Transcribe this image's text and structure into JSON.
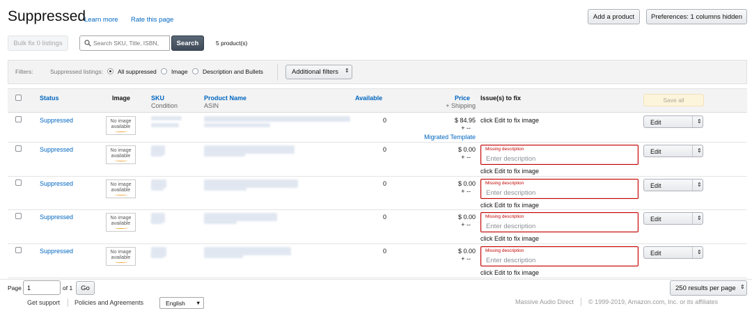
{
  "header": {
    "title": "Suppressed",
    "learn_more": "Learn more",
    "rate_page": "Rate this page",
    "add_product": "Add a product",
    "preferences": "Preferences: 1 columns hidden"
  },
  "toolbar": {
    "bulk_fix": "Bulk fix 0 listings",
    "search_placeholder": "Search SKU, Title, ISBN,",
    "search_button": "Search",
    "product_count": "5 product(s)"
  },
  "filters": {
    "label": "Filters:",
    "group_label": "Suppressed listings:",
    "options": [
      {
        "label": "All suppressed",
        "selected": true
      },
      {
        "label": "Image",
        "selected": false
      },
      {
        "label": "Description and Bullets",
        "selected": false
      }
    ],
    "additional": "Additional filters",
    "additional_arrow": "⇕"
  },
  "table": {
    "headers": {
      "status": "Status",
      "image": "Image",
      "sku": "SKU",
      "sku_sub": "Condition",
      "product_name": "Product Name",
      "product_sub": "ASIN",
      "available": "Available",
      "price": "Price",
      "price_sub": "+ Shipping",
      "issues": "Issue(s) to fix",
      "save_all": "Save all"
    },
    "no_image_line1": "No image",
    "no_image_line2": "available",
    "rows": [
      {
        "status": "Suppressed",
        "available": "0",
        "price": "$ 84.95",
        "shipping": "+ --",
        "extra": "Migrated Template",
        "issue_label": "",
        "issue_placeholder": "",
        "fix_text": "click Edit to fix image",
        "edit": "Edit",
        "edit_arrow": "⇕"
      },
      {
        "status": "Suppressed",
        "available": "0",
        "price": "$ 0.00",
        "shipping": "+ --",
        "extra": "",
        "issue_label": "Missing description",
        "issue_placeholder": "Enter description",
        "fix_text": "click Edit to fix image",
        "edit": "Edit",
        "edit_arrow": "⇕"
      },
      {
        "status": "Suppressed",
        "available": "0",
        "price": "$ 0.00",
        "shipping": "+ --",
        "extra": "",
        "issue_label": "Missing description",
        "issue_placeholder": "Enter description",
        "fix_text": "click Edit to fix image",
        "edit": "Edit",
        "edit_arrow": "⇕"
      },
      {
        "status": "Suppressed",
        "available": "0",
        "price": "$ 0.00",
        "shipping": "+ --",
        "extra": "",
        "issue_label": "Missing description",
        "issue_placeholder": "Enter description",
        "fix_text": "click Edit to fix image",
        "edit": "Edit",
        "edit_arrow": "⇕"
      },
      {
        "status": "Suppressed",
        "available": "0",
        "price": "$ 0.00",
        "shipping": "+ --",
        "extra": "",
        "issue_label": "Missing description",
        "issue_placeholder": "Enter description",
        "fix_text": "click Edit to fix image",
        "edit": "Edit",
        "edit_arrow": "⇕"
      }
    ]
  },
  "pagination": {
    "page_label": "Page",
    "page_value": "1",
    "of_label": "of 1",
    "go": "Go",
    "per_page": "250 results per page",
    "per_page_arrow": "⇕"
  },
  "footer": {
    "support": "Get support",
    "policies": "Policies and Agreements",
    "language": "English",
    "language_arrow": "▼",
    "store": "Massive Audio Direct",
    "copyright": "© 1999-2019, Amazon.com, Inc. or its affiliates"
  },
  "colors": {
    "link": "#0066c0",
    "error": "#c40000",
    "save_all_bg": "#fdf4dc"
  },
  "icons": {
    "search": "search-icon",
    "dropdown": "chevron-updown-icon"
  }
}
